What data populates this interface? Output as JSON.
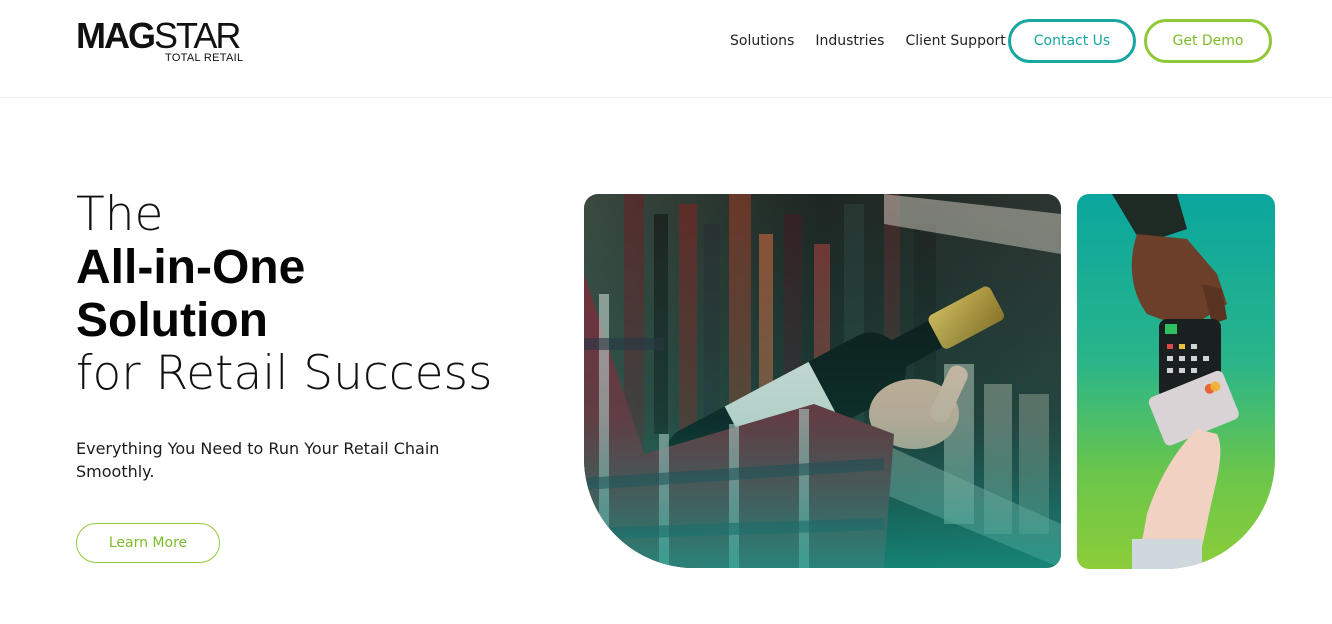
{
  "header": {
    "logo": {
      "main_bold": "MAG",
      "main_light": "STAR",
      "sub": "TOTAL RETAIL"
    },
    "nav": [
      {
        "label": "Solutions"
      },
      {
        "label": "Industries"
      },
      {
        "label": "Client Support"
      }
    ],
    "contact_button": "Contact Us",
    "demo_button": "Get Demo"
  },
  "hero": {
    "title_line1": "The",
    "title_line2": "All-in-One",
    "title_line3": "Solution",
    "title_line4": "for Retail Success",
    "subtitle": "Everything You Need to Run Your Retail Chain Smoothly.",
    "cta": "Learn More"
  },
  "colors": {
    "teal": "#17a6a0",
    "green": "#8fc93a",
    "text": "#111111"
  },
  "images": {
    "main": "wine-bottle-shopping-photo",
    "side": "card-payment-terminal-photo"
  }
}
